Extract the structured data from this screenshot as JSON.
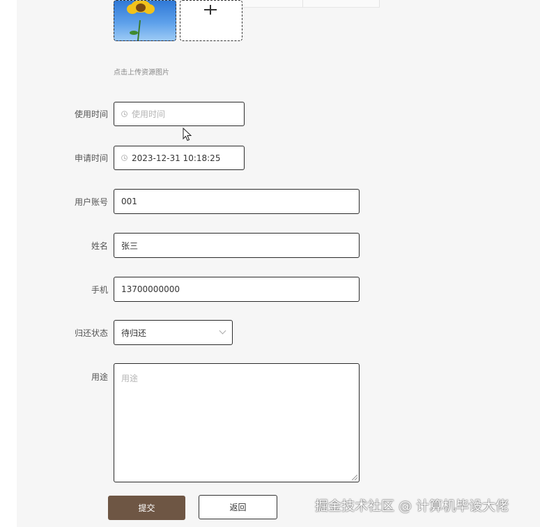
{
  "upload": {
    "hint": "点击上传资源图片",
    "add_icon": "plus-icon"
  },
  "form": {
    "use_time": {
      "label": "使用时间",
      "placeholder": "使用时间",
      "value": ""
    },
    "apply_time": {
      "label": "申请时间",
      "value": "2023-12-31 10:18:25"
    },
    "account": {
      "label": "用户账号",
      "value": "001"
    },
    "name": {
      "label": "姓名",
      "value": "张三"
    },
    "phone": {
      "label": "手机",
      "value": "13700000000"
    },
    "return_status": {
      "label": "归还状态",
      "value": "待归还"
    },
    "purpose": {
      "label": "用途",
      "placeholder": "用途",
      "value": ""
    }
  },
  "buttons": {
    "submit": "提交",
    "back": "返回"
  },
  "watermark": "掘金技术社区 @ 计算机毕设大佬",
  "colors": {
    "submit_bg": "#6e5644",
    "panel_bg": "#f6f6f6",
    "border": "#2b2b2b"
  }
}
